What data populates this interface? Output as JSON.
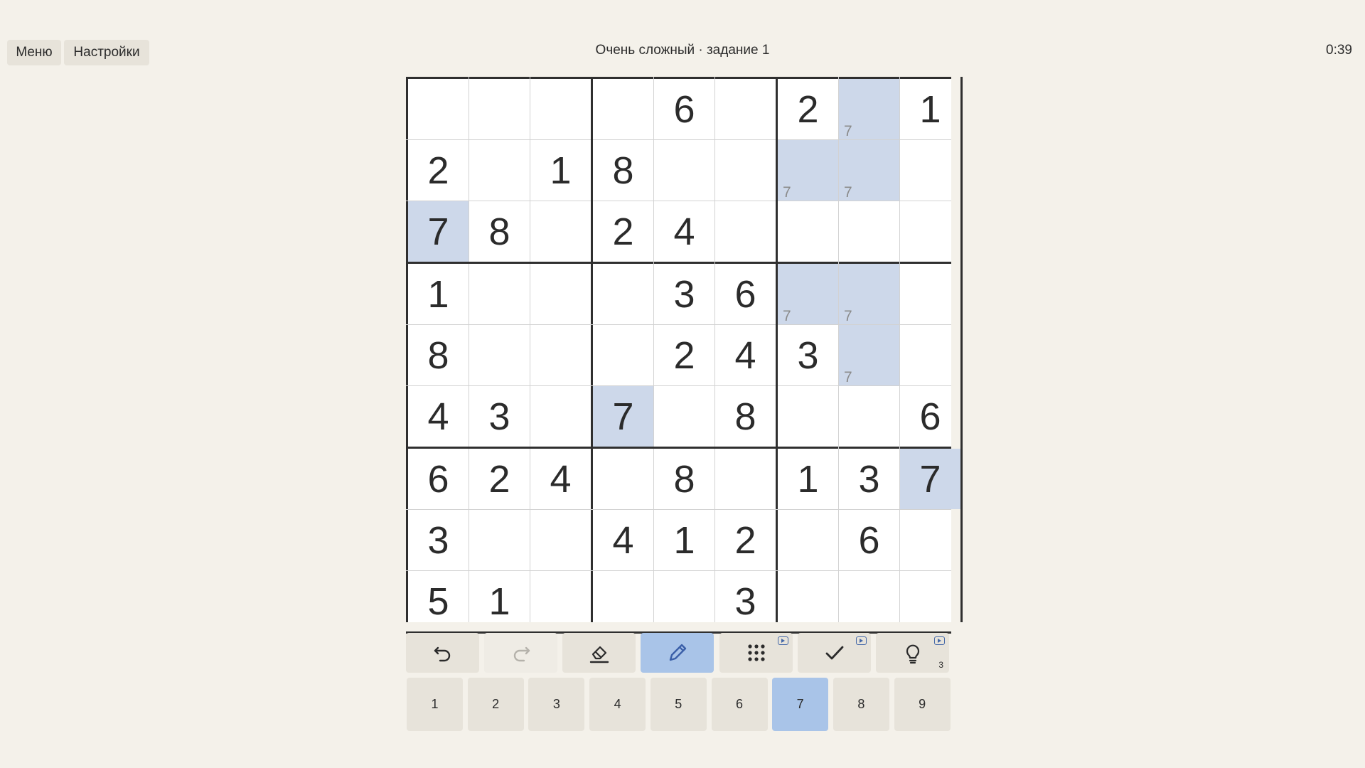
{
  "header": {
    "menu_label": "Меню",
    "settings_label": "Настройки",
    "title": "Очень сложный · задание 1",
    "timer": "0:39"
  },
  "board": {
    "values": [
      [
        "",
        "",
        "",
        "",
        "6",
        "",
        "2",
        "",
        "1"
      ],
      [
        "2",
        "",
        "1",
        "8",
        "",
        "",
        "",
        "",
        ""
      ],
      [
        "7",
        "8",
        "",
        "2",
        "4",
        "",
        "",
        "",
        ""
      ],
      [
        "1",
        "",
        "",
        "",
        "3",
        "6",
        "",
        "",
        ""
      ],
      [
        "8",
        "",
        "",
        "",
        "2",
        "4",
        "3",
        "",
        ""
      ],
      [
        "4",
        "3",
        "",
        "7",
        "",
        "8",
        "",
        "",
        "6"
      ],
      [
        "6",
        "2",
        "4",
        "",
        "8",
        "",
        "1",
        "3",
        "7"
      ],
      [
        "3",
        "",
        "",
        "4",
        "1",
        "2",
        "",
        "6",
        ""
      ],
      [
        "5",
        "1",
        "",
        "",
        "",
        "3",
        "",
        "",
        ""
      ]
    ],
    "notes": [
      {
        "row": 0,
        "col": 7,
        "text": "7"
      },
      {
        "row": 1,
        "col": 6,
        "text": "7"
      },
      {
        "row": 1,
        "col": 7,
        "text": "7"
      },
      {
        "row": 3,
        "col": 6,
        "text": "7"
      },
      {
        "row": 3,
        "col": 7,
        "text": "7"
      },
      {
        "row": 4,
        "col": 7,
        "text": "7"
      }
    ],
    "highlighted": [
      [
        0,
        7
      ],
      [
        1,
        6
      ],
      [
        1,
        7
      ],
      [
        2,
        0
      ],
      [
        3,
        6
      ],
      [
        3,
        7
      ],
      [
        4,
        7
      ],
      [
        5,
        3
      ],
      [
        6,
        8
      ]
    ],
    "highlight_color": "#cdd8ea"
  },
  "toolbar": {
    "tools": [
      {
        "name": "undo-button",
        "icon": "undo-icon",
        "state": "normal"
      },
      {
        "name": "redo-button",
        "icon": "redo-icon",
        "state": "disabled"
      },
      {
        "name": "erase-button",
        "icon": "eraser-icon",
        "state": "normal"
      },
      {
        "name": "pencil-button",
        "icon": "pencil-icon",
        "state": "active"
      },
      {
        "name": "notes-grid-button",
        "icon": "dots-grid-icon",
        "state": "normal",
        "badge": true
      },
      {
        "name": "check-button",
        "icon": "check-icon",
        "state": "normal",
        "badge": true
      },
      {
        "name": "hint-button",
        "icon": "lightbulb-icon",
        "state": "normal",
        "badge": true,
        "count": "3"
      }
    ],
    "active_color": "#a9c4e8"
  },
  "numpad": {
    "digits": [
      "1",
      "2",
      "3",
      "4",
      "5",
      "6",
      "7",
      "8",
      "9"
    ],
    "selected": "7"
  }
}
